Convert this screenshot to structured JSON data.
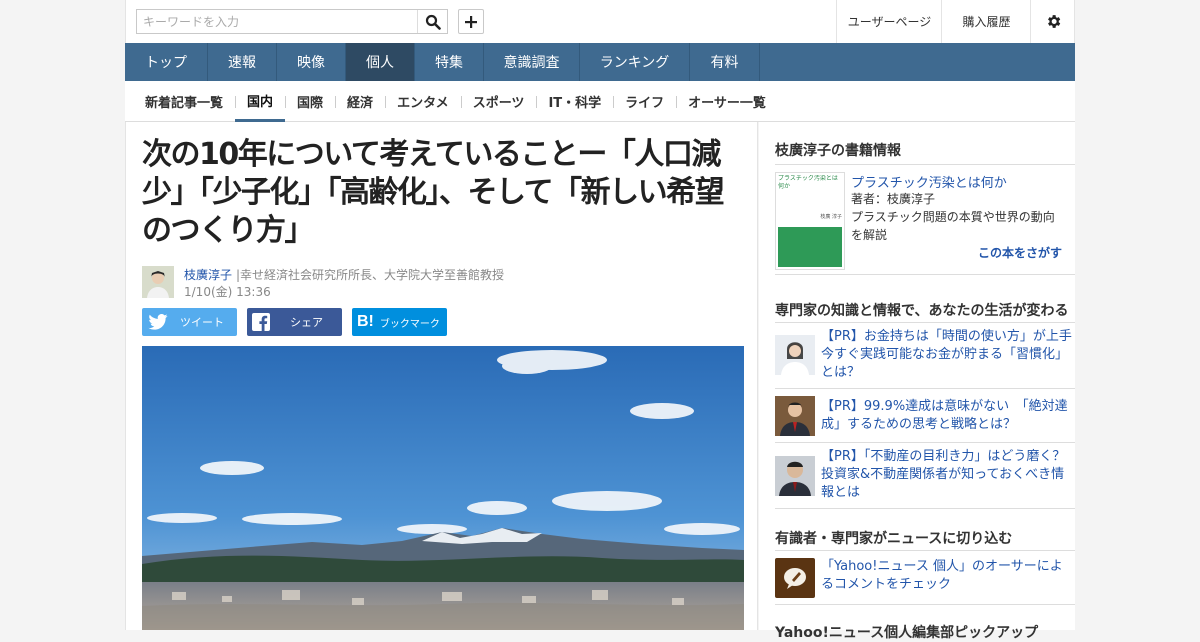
{
  "header": {
    "search_placeholder": "キーワードを入力",
    "search_icon": "search-icon",
    "add_icon": "plus-icon",
    "user_page": "ユーザーページ",
    "purchase_history": "購入履歴",
    "settings_icon": "gear-icon"
  },
  "main_nav": [
    "トップ",
    "速報",
    "映像",
    "個人",
    "特集",
    "意識調査",
    "ランキング",
    "有料"
  ],
  "main_nav_active": "個人",
  "sub_nav": [
    "新着記事一覧",
    "国内",
    "国際",
    "経済",
    "エンタメ",
    "スポーツ",
    "IT・科学",
    "ライフ",
    "オーサー一覧"
  ],
  "sub_nav_active": "国内",
  "article": {
    "title": "次の10年について考えていることー「人口減少」「少子化」「高齢化」、そして「新しい希望のつくり方」",
    "author_name": "枝廣淳子",
    "author_title": "|幸せ経済社会研究所所長、大学院大学至善館教授",
    "date": "1/10(金) 13:36",
    "share": {
      "tweet": "ツイート",
      "share": "シェア",
      "bookmark": "ブックマーク"
    }
  },
  "sidebar": {
    "books_heading": "枝廣淳子の書籍情報",
    "book": {
      "title": "プラスチック汚染とは何か",
      "author": "著者：枝廣淳子",
      "description": "プラスチック問題の本質や世界の動向を解説",
      "find": "この本をさがす",
      "cover_title": "プラスチック汚染とは何か",
      "cover_author": "枝廣 淳子"
    },
    "experts_heading": "専門家の知識と情報で、あなたの生活が変わる",
    "pr_items": [
      "【PR】お金持ちは「時間の使い方」が上手　今すぐ実践可能なお金が貯まる「習慣化」とは？",
      "【PR】99.9%達成は意味がない　「絶対達成」するための思考と戦略とは？",
      "【PR】「不動産の目利き力」はどう磨く？　投資家&不動産関係者が知っておくべき情報とは"
    ],
    "comments_heading": "有識者・専門家がニュースに切り込む",
    "comments_link": "「Yahoo!ニュース 個人」のオーサーによるコメントをチェック",
    "next_heading": "Yahoo!ニュース個人編集部ピックアップ"
  },
  "colors": {
    "nav": "#3f6a90",
    "nav_active": "#2e4a63",
    "twitter": "#55acee",
    "facebook": "#3b5998",
    "hatena": "#008fde",
    "link": "#2255aa"
  }
}
